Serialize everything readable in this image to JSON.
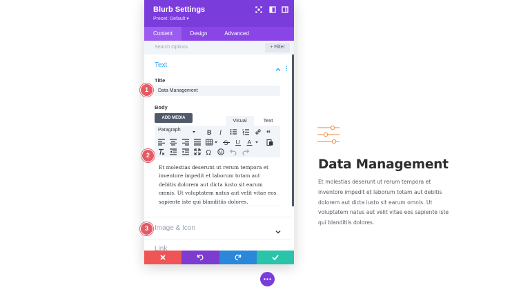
{
  "panel": {
    "title": "Blurb Settings",
    "preset": "Preset: Default ▾",
    "tabs": [
      "Content",
      "Design",
      "Advanced"
    ],
    "active_tab": "Content",
    "search_placeholder": "Search Options",
    "filter_label": "+ Filter",
    "accent_color": "#7b3cdc"
  },
  "text_section": {
    "title": "Text",
    "title_field_label": "Title",
    "title_value": "Data Management",
    "body_label": "Body",
    "add_media_label": "ADD MEDIA",
    "editor_tabs": [
      "Visual",
      "Text"
    ],
    "paragraph_select": "Paragraph",
    "body_text": "Et molestias deserunt ut rerum tempora et inventore impedit et laborum totam aut debitis dolorem aut dicta iusto sit earum omnis. Ut voluptatem natus aut velit vitae eos sapiente iste qui blanditiis dolores."
  },
  "collapsed_sections": [
    "Image & Icon",
    "Link"
  ],
  "bottom_actions": [
    {
      "name": "cancel",
      "icon": "close-icon",
      "color": "#ef5555"
    },
    {
      "name": "undo",
      "icon": "undo-icon",
      "color": "#7e3bd0"
    },
    {
      "name": "redo",
      "icon": "redo-icon",
      "color": "#2b87da"
    },
    {
      "name": "save",
      "icon": "check-icon",
      "color": "#29c4a9"
    }
  ],
  "badges": [
    "1",
    "2",
    "3"
  ],
  "preview": {
    "title": "Data Management",
    "body": "Et molestias deserunt ut rerum tempora et inventore impedit et laborum totam aut debitis dolorem aut dicta iusto sit earum omnis. Ut voluptatem natus aut velit vitae eos sapiente iste qui blanditiis dolores.",
    "icon": "sliders-icon",
    "icon_color": "#f39c5a"
  }
}
